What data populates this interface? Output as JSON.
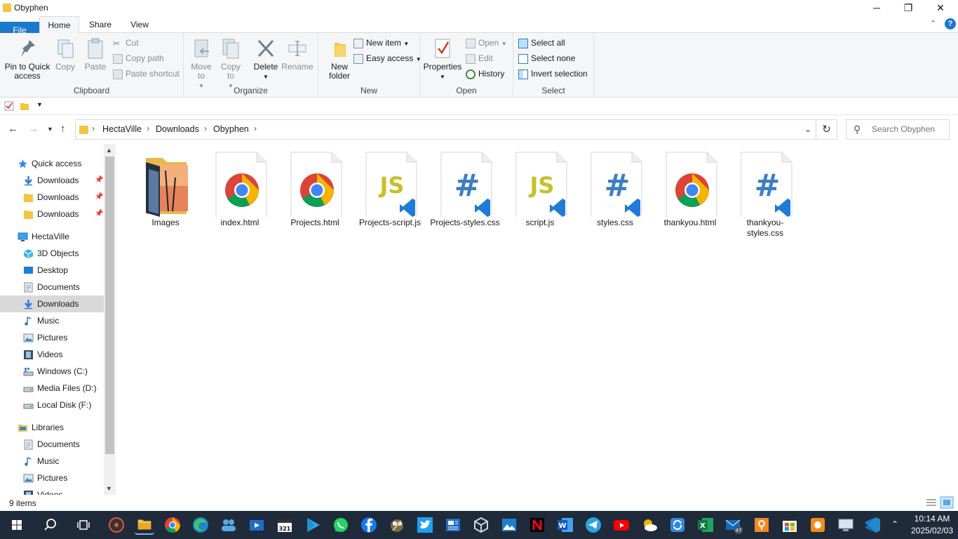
{
  "window": {
    "title": "Obyphen",
    "minimize_glyph": "─",
    "maximize_glyph": "❐",
    "close_glyph": "✕"
  },
  "tabs": {
    "file": "File",
    "home": "Home",
    "share": "Share",
    "view": "View",
    "help_glyph": "?"
  },
  "ribbon": {
    "clipboard": {
      "label": "Clipboard",
      "pin": "Pin to Quick access",
      "copy": "Copy",
      "paste": "Paste",
      "cut": "Cut",
      "copy_path": "Copy path",
      "paste_shortcut": "Paste shortcut"
    },
    "organize": {
      "label": "Organize",
      "move_to": "Move to",
      "copy_to": "Copy to",
      "delete": "Delete",
      "rename": "Rename"
    },
    "new": {
      "label": "New",
      "new_folder": "New folder",
      "new_item": "New item",
      "easy_access": "Easy access"
    },
    "open": {
      "label": "Open",
      "properties": "Properties",
      "open": "Open",
      "edit": "Edit",
      "history": "History"
    },
    "select": {
      "label": "Select",
      "select_all": "Select all",
      "select_none": "Select none",
      "invert_selection": "Invert selection"
    }
  },
  "breadcrumb": {
    "items": [
      "HectaVille",
      "Downloads",
      "Obyphen"
    ]
  },
  "search": {
    "placeholder": "Search Obyphen"
  },
  "navpane": {
    "quick_access": "Quick access",
    "quick_items": [
      "Downloads",
      "Downloads",
      "Downloads"
    ],
    "this_pc": "HectaVille",
    "pc_items": [
      "3D Objects",
      "Desktop",
      "Documents",
      "Downloads",
      "Music",
      "Pictures",
      "Videos",
      "Windows (C:)",
      "Media Files (D:)",
      "Local Disk (F:)"
    ],
    "libraries": "Libraries",
    "library_items": [
      "Documents",
      "Music",
      "Pictures",
      "Videos"
    ],
    "selected": "Downloads"
  },
  "files": [
    {
      "name": "Images",
      "type": "folder"
    },
    {
      "name": "index.html",
      "type": "chrome-html"
    },
    {
      "name": "Projects.html",
      "type": "chrome-html"
    },
    {
      "name": "Projects-script.js",
      "type": "js"
    },
    {
      "name": "Projects-styles.css",
      "type": "css"
    },
    {
      "name": "script.js",
      "type": "js"
    },
    {
      "name": "styles.css",
      "type": "css"
    },
    {
      "name": "thankyou.html",
      "type": "chrome-html"
    },
    {
      "name": "thankyou-styles.css",
      "type": "css"
    }
  ],
  "status": {
    "item_count": "9 items"
  },
  "taskbar": {
    "time": "10:14 AM",
    "date": "2025/02/03",
    "mail_badge": "47",
    "calendar_badge": "321",
    "apps": [
      "windows-start",
      "search",
      "task-view",
      "media-player",
      "file-explorer",
      "chrome",
      "edge",
      "people",
      "movies",
      "calendar",
      "play-store",
      "whatsapp",
      "facebook",
      "gimp",
      "twitter",
      "news",
      "virtualbox",
      "photos",
      "netflix",
      "word",
      "telegram",
      "youtube",
      "weather",
      "sync",
      "excel",
      "mail",
      "maps",
      "store",
      "presenter",
      "network",
      "vscode"
    ]
  },
  "colors": {
    "file_tab": "#1979ca",
    "taskbar": "#1f2a3a",
    "folder": "#f4c542",
    "js_yellow": "#c7c02b",
    "css_blue": "#3b7fc4",
    "vscode_blue": "#1f7bd8"
  }
}
